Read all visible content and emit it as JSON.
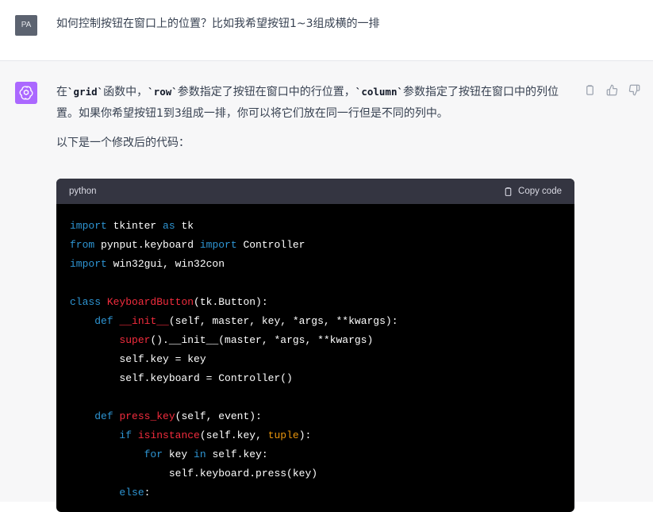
{
  "user": {
    "avatar": "PA",
    "message": "如何控制按钮在窗口上的位置？比如我希望按钮1~3组成横的一排"
  },
  "assistant": {
    "p1_a": "在",
    "p1_code1": "`grid`",
    "p1_b": "函数中，",
    "p1_code2": "`row`",
    "p1_c": "参数指定了按钮在窗口中的行位置，",
    "p1_code3": "`column`",
    "p1_d": "参数指定了按钮在窗口中的列位置。如果你希望按钮1到3组成一排，你可以将它们放在同一行但是不同的列中。",
    "p2": "以下是一个修改后的代码：",
    "actions": [
      "clipboard-icon",
      "thumbs-up-icon",
      "thumbs-down-icon"
    ]
  },
  "code": {
    "language": "python",
    "copy_label": "Copy code",
    "lines": [
      "import tkinter as tk",
      "from pynput.keyboard import Controller",
      "import win32gui, win32con",
      "",
      "class KeyboardButton(tk.Button):",
      "    def __init__(self, master, key, *args, **kwargs):",
      "        super().__init__(master, *args, **kwargs)",
      "        self.key = key",
      "        self.keyboard = Controller()",
      "",
      "    def press_key(self, event):",
      "        if isinstance(self.key, tuple):",
      "            for key in self.key:",
      "                self.keyboard.press(key)",
      "        else:"
    ]
  },
  "colors": {
    "avatar_user": "#5c6370",
    "avatar_assistant": "#ab68ff",
    "keyword": "#2e95d3",
    "class_name": "#f22c3d",
    "builtin": "#e9950c",
    "code_bg": "#000000",
    "code_header_bg": "#343541"
  }
}
